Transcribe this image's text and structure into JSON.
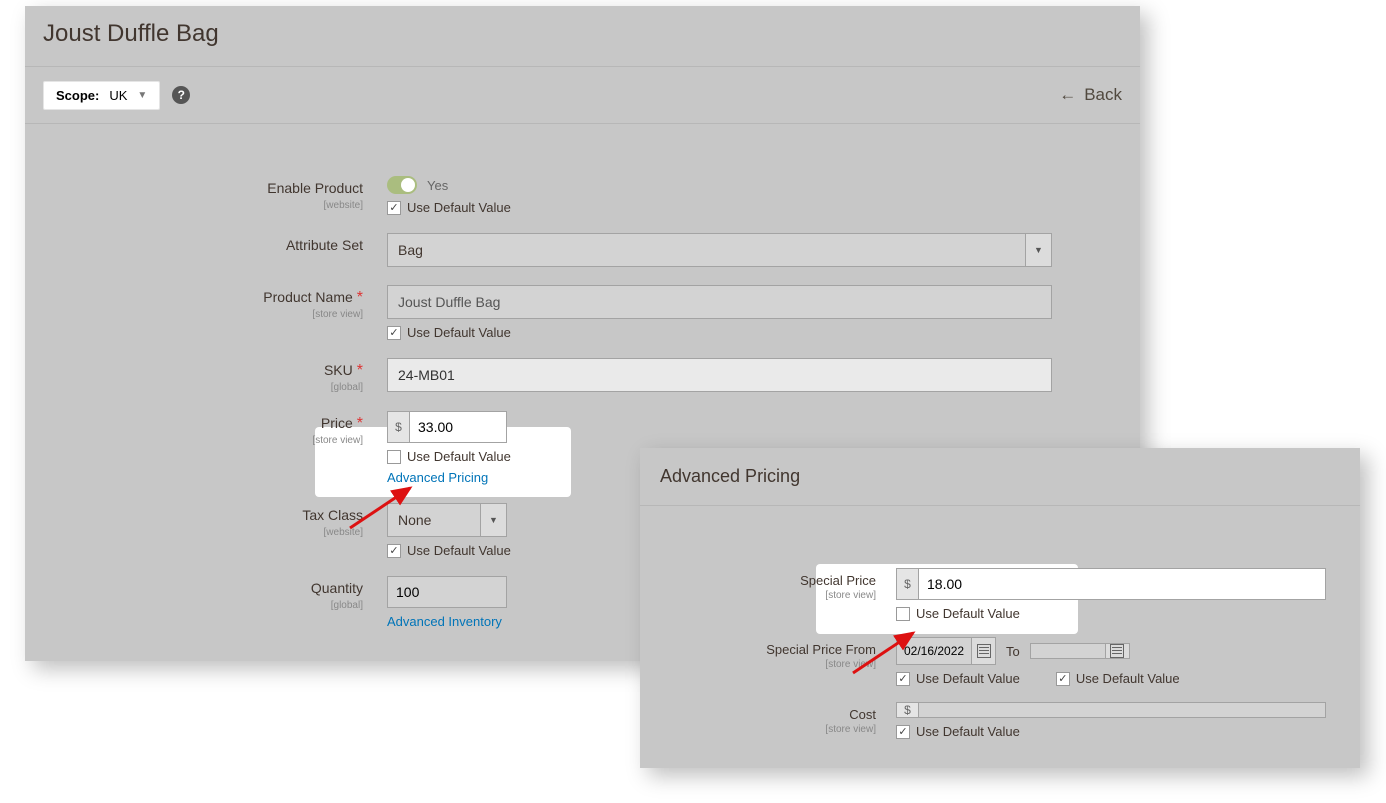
{
  "page": {
    "title": "Joust Duffle Bag",
    "scope_label": "Scope:",
    "scope": "UK",
    "back": "Back"
  },
  "udv": "Use Default Value",
  "fields": {
    "enable": {
      "label": "Enable Product",
      "scope": "[website]",
      "yes": "Yes"
    },
    "attrset": {
      "label": "Attribute Set",
      "value": "Bag"
    },
    "name": {
      "label": "Product Name",
      "scope": "[store view]",
      "value": "Joust Duffle Bag"
    },
    "sku": {
      "label": "SKU",
      "scope": "[global]",
      "value": "24-MB01"
    },
    "price": {
      "label": "Price",
      "scope": "[store view]",
      "currency": "$",
      "value": "33.00",
      "advanced": "Advanced Pricing"
    },
    "tax": {
      "label": "Tax Class",
      "scope": "[website]",
      "value": "None"
    },
    "qty": {
      "label": "Quantity",
      "scope": "[global]",
      "value": "100",
      "advanced": "Advanced Inventory"
    }
  },
  "ap": {
    "title": "Advanced Pricing",
    "special": {
      "label": "Special Price",
      "scope": "[store view]",
      "currency": "$",
      "value": "18.00"
    },
    "from": {
      "label": "Special Price From",
      "scope": "[store view]",
      "value": "02/16/2022",
      "to": "To"
    },
    "cost": {
      "label": "Cost",
      "scope": "[store view]",
      "currency": "$"
    }
  }
}
